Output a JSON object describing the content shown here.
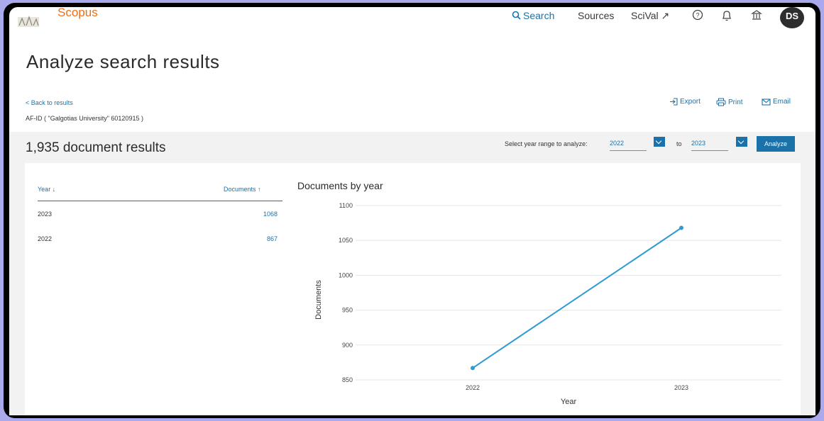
{
  "nav": {
    "logo_text": "Scopus",
    "items": [
      {
        "label": "Search",
        "icon": "search-icon"
      },
      {
        "label": "Sources"
      },
      {
        "label": "SciVal ↗"
      }
    ],
    "avatar_initials": "DS"
  },
  "page": {
    "title": "Analyze search results",
    "back_link": "< Back to results",
    "query": "AF-ID ( \"Galgotias University\"  60120915 )",
    "actions": [
      {
        "label": "Export",
        "icon": "export-icon"
      },
      {
        "label": "Print",
        "icon": "print-icon"
      },
      {
        "label": "Email",
        "icon": "email-icon"
      }
    ]
  },
  "results": {
    "count_text": "1,935 document results",
    "range_label": "Select year range to analyze:",
    "from_year": "2022",
    "to_label": "to",
    "to_year": "2023",
    "analyze_label": "Analyze"
  },
  "table": {
    "col_year": "Year ↓",
    "col_docs": "Documents ↑",
    "rows": [
      {
        "year": "2023",
        "docs": "1068"
      },
      {
        "year": "2022",
        "docs": "867"
      }
    ]
  },
  "chart_data": {
    "type": "line",
    "title": "Documents by year",
    "xlabel": "Year",
    "ylabel": "Documents",
    "categories": [
      "2022",
      "2023"
    ],
    "values": [
      867,
      1068
    ],
    "ylim": [
      850,
      1100
    ],
    "yticks": [
      850,
      900,
      950,
      1000,
      1050,
      1100
    ],
    "grid": true,
    "color": "#2e9bd2"
  },
  "colors": {
    "accent": "#1a72a8",
    "brand": "#e9711c"
  }
}
